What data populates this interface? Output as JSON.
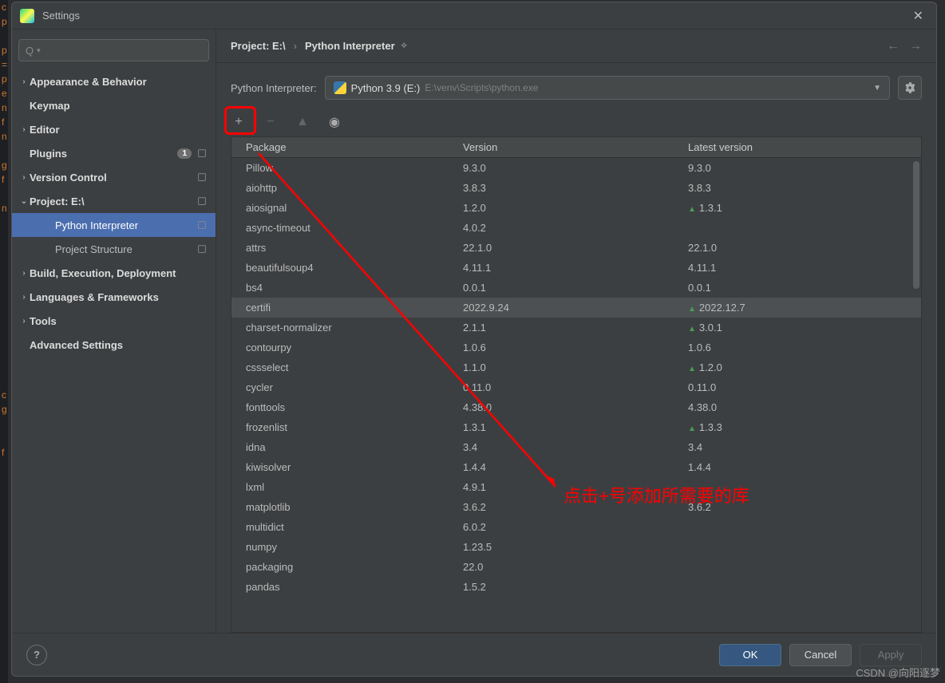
{
  "window": {
    "title": "Settings"
  },
  "breadcrumb": {
    "part1": "Project: E:\\",
    "part2": "Python Interpreter"
  },
  "sidebar": {
    "items": [
      {
        "label": "Appearance & Behavior",
        "arrow": "›"
      },
      {
        "label": "Keymap",
        "arrow": ""
      },
      {
        "label": "Editor",
        "arrow": "›"
      },
      {
        "label": "Plugins",
        "arrow": "",
        "badge": "1",
        "gear": true
      },
      {
        "label": "Version Control",
        "arrow": "›",
        "gear": true
      },
      {
        "label": "Project: E:\\",
        "arrow": "⌄",
        "gear": true
      },
      {
        "label": "Python Interpreter",
        "child": true,
        "selected": true,
        "gear": true
      },
      {
        "label": "Project Structure",
        "child": true,
        "gear": true
      },
      {
        "label": "Build, Execution, Deployment",
        "arrow": "›"
      },
      {
        "label": "Languages & Frameworks",
        "arrow": "›"
      },
      {
        "label": "Tools",
        "arrow": "›"
      },
      {
        "label": "Advanced Settings",
        "arrow": ""
      }
    ]
  },
  "interpreter": {
    "label": "Python Interpreter:",
    "name": "Python 3.9 (E:)",
    "path": "E:\\venv\\Scripts\\python.exe"
  },
  "table": {
    "headers": {
      "pkg": "Package",
      "ver": "Version",
      "lat": "Latest version"
    },
    "rows": [
      {
        "pkg": "Pillow",
        "ver": "9.3.0",
        "lat": "9.3.0"
      },
      {
        "pkg": "aiohttp",
        "ver": "3.8.3",
        "lat": "3.8.3"
      },
      {
        "pkg": "aiosignal",
        "ver": "1.2.0",
        "lat": "1.3.1",
        "up": true
      },
      {
        "pkg": "async-timeout",
        "ver": "4.0.2",
        "lat": ""
      },
      {
        "pkg": "attrs",
        "ver": "22.1.0",
        "lat": "22.1.0"
      },
      {
        "pkg": "beautifulsoup4",
        "ver": "4.11.1",
        "lat": "4.11.1"
      },
      {
        "pkg": "bs4",
        "ver": "0.0.1",
        "lat": "0.0.1"
      },
      {
        "pkg": "certifi",
        "ver": "2022.9.24",
        "lat": "2022.12.7",
        "up": true,
        "hov": true
      },
      {
        "pkg": "charset-normalizer",
        "ver": "2.1.1",
        "lat": "3.0.1",
        "up": true
      },
      {
        "pkg": "contourpy",
        "ver": "1.0.6",
        "lat": "1.0.6"
      },
      {
        "pkg": "cssselect",
        "ver": "1.1.0",
        "lat": "1.2.0",
        "up": true
      },
      {
        "pkg": "cycler",
        "ver": "0.11.0",
        "lat": "0.11.0"
      },
      {
        "pkg": "fonttools",
        "ver": "4.38.0",
        "lat": "4.38.0"
      },
      {
        "pkg": "frozenlist",
        "ver": "1.3.1",
        "lat": "1.3.3",
        "up": true
      },
      {
        "pkg": "idna",
        "ver": "3.4",
        "lat": "3.4"
      },
      {
        "pkg": "kiwisolver",
        "ver": "1.4.4",
        "lat": "1.4.4"
      },
      {
        "pkg": "lxml",
        "ver": "4.9.1",
        "lat": ""
      },
      {
        "pkg": "matplotlib",
        "ver": "3.6.2",
        "lat": "3.6.2"
      },
      {
        "pkg": "multidict",
        "ver": "6.0.2",
        "lat": ""
      },
      {
        "pkg": "numpy",
        "ver": "1.23.5",
        "lat": ""
      },
      {
        "pkg": "packaging",
        "ver": "22.0",
        "lat": ""
      },
      {
        "pkg": "pandas",
        "ver": "1.5.2",
        "lat": ""
      }
    ]
  },
  "footer": {
    "ok": "OK",
    "cancel": "Cancel",
    "apply": "Apply"
  },
  "annotation": {
    "text": "点击+号添加所需要的库"
  },
  "watermark": "CSDN @向阳逐梦"
}
